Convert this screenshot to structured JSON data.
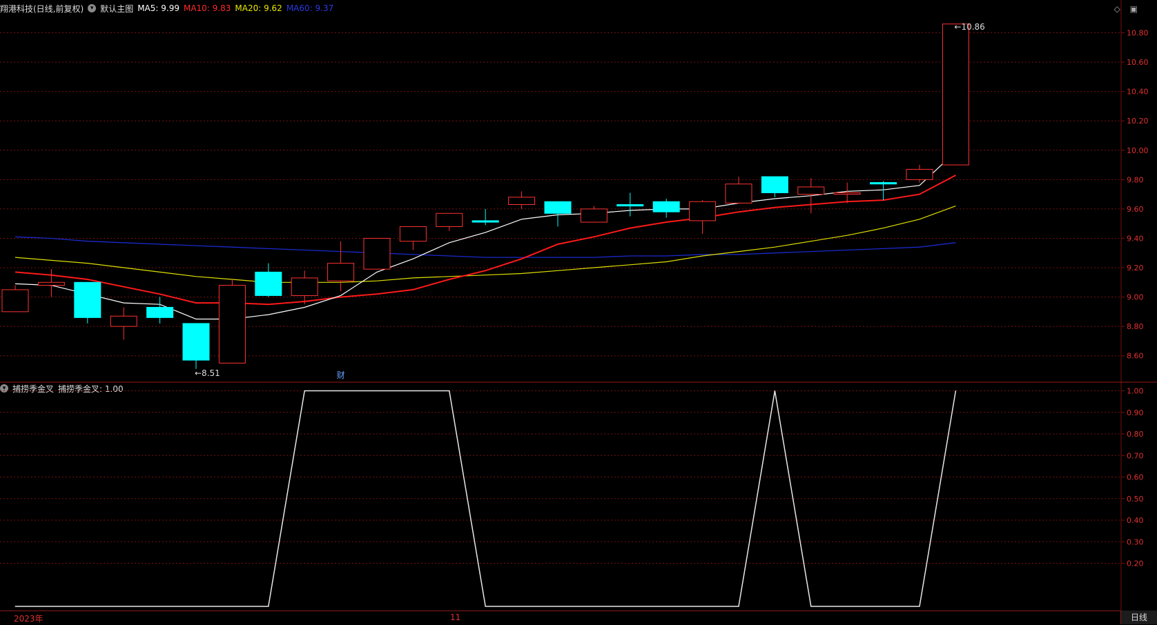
{
  "header": {
    "stock_title": "翔港科技(日线,前复权)",
    "chart_name": "默认主图",
    "ma5_label": "MA5: 9.99",
    "ma10_label": "MA10: 9.83",
    "ma20_label": "MA20: 9.62",
    "ma60_label": "MA60: 9.37"
  },
  "indicator": {
    "name": "捕捞季金叉",
    "value_label": "捕捞季金叉: 1.00"
  },
  "bottom": {
    "year_label": "2023年",
    "month_label": "11",
    "period_tab": "日线"
  },
  "colors": {
    "up": "#ff3333",
    "down": "#00ffff",
    "ma5": "#ffffff",
    "ma10": "#ff1a1a",
    "ma20": "#e0e000",
    "ma60": "#1a2acc",
    "grid": "#7a1010",
    "axis_text": "#e03030"
  },
  "chart_data": [
    {
      "type": "candlestick",
      "title": "翔港科技(日线,前复权)",
      "ylim": [
        8.42,
        10.92
      ],
      "y_ticks": [
        "10.80",
        "10.60",
        "10.40",
        "10.20",
        "10.00",
        "9.80",
        "9.60",
        "9.40",
        "9.20",
        "9.00",
        "8.80",
        "8.60"
      ],
      "candles": [
        {
          "o": 8.9,
          "h": 9.08,
          "l": 8.9,
          "c": 9.05
        },
        {
          "o": 9.08,
          "h": 9.19,
          "l": 9.0,
          "c": 9.1
        },
        {
          "o": 9.1,
          "h": 9.1,
          "l": 8.82,
          "c": 8.86
        },
        {
          "o": 8.8,
          "h": 8.93,
          "l": 8.71,
          "c": 8.87
        },
        {
          "o": 8.93,
          "h": 9.0,
          "l": 8.82,
          "c": 8.86
        },
        {
          "o": 8.82,
          "h": 8.82,
          "l": 8.51,
          "c": 8.57
        },
        {
          "o": 8.55,
          "h": 9.12,
          "l": 8.55,
          "c": 9.08
        },
        {
          "o": 9.17,
          "h": 9.23,
          "l": 9.0,
          "c": 9.01
        },
        {
          "o": 9.01,
          "h": 9.18,
          "l": 8.95,
          "c": 9.13
        },
        {
          "o": 9.11,
          "h": 9.38,
          "l": 9.04,
          "c": 9.23
        },
        {
          "o": 9.19,
          "h": 9.4,
          "l": 9.19,
          "c": 9.4
        },
        {
          "o": 9.38,
          "h": 9.48,
          "l": 9.32,
          "c": 9.48
        },
        {
          "o": 9.48,
          "h": 9.56,
          "l": 9.45,
          "c": 9.57
        },
        {
          "o": 9.52,
          "h": 9.6,
          "l": 9.49,
          "c": 9.51
        },
        {
          "o": 9.63,
          "h": 9.72,
          "l": 9.6,
          "c": 9.68
        },
        {
          "o": 9.65,
          "h": 9.65,
          "l": 9.48,
          "c": 9.57
        },
        {
          "o": 9.51,
          "h": 9.62,
          "l": 9.51,
          "c": 9.6
        },
        {
          "o": 9.63,
          "h": 9.71,
          "l": 9.55,
          "c": 9.62
        },
        {
          "o": 9.65,
          "h": 9.67,
          "l": 9.54,
          "c": 9.58
        },
        {
          "o": 9.52,
          "h": 9.66,
          "l": 9.43,
          "c": 9.65
        },
        {
          "o": 9.64,
          "h": 9.82,
          "l": 9.64,
          "c": 9.77
        },
        {
          "o": 9.82,
          "h": 9.82,
          "l": 9.68,
          "c": 9.71
        },
        {
          "o": 9.7,
          "h": 9.81,
          "l": 9.57,
          "c": 9.75
        },
        {
          "o": 9.71,
          "h": 9.78,
          "l": 9.64,
          "c": 9.71
        },
        {
          "o": 9.78,
          "h": 9.79,
          "l": 9.66,
          "c": 9.77
        },
        {
          "o": 9.8,
          "h": 9.9,
          "l": 9.78,
          "c": 9.87
        },
        {
          "o": 9.9,
          "h": 10.86,
          "l": 9.9,
          "c": 10.86
        }
      ],
      "ma5": [
        9.09,
        9.08,
        9.02,
        8.96,
        8.95,
        8.85,
        8.85,
        8.88,
        8.93,
        9.01,
        9.17,
        9.26,
        9.37,
        9.44,
        9.53,
        9.56,
        9.57,
        9.59,
        9.6,
        9.6,
        9.64,
        9.67,
        9.69,
        9.72,
        9.73,
        9.76,
        9.99
      ],
      "ma10": [
        9.17,
        9.15,
        9.12,
        9.07,
        9.02,
        8.96,
        8.96,
        8.95,
        8.97,
        9.0,
        9.02,
        9.05,
        9.12,
        9.18,
        9.26,
        9.36,
        9.41,
        9.47,
        9.51,
        9.54,
        9.58,
        9.61,
        9.63,
        9.65,
        9.66,
        9.7,
        9.83
      ],
      "ma20": [
        9.27,
        9.25,
        9.23,
        9.2,
        9.17,
        9.14,
        9.12,
        9.1,
        9.1,
        9.1,
        9.11,
        9.13,
        9.14,
        9.15,
        9.16,
        9.18,
        9.2,
        9.22,
        9.24,
        9.28,
        9.31,
        9.34,
        9.38,
        9.42,
        9.47,
        9.53,
        9.62
      ],
      "ma60": [
        9.41,
        9.4,
        9.38,
        9.37,
        9.36,
        9.35,
        9.34,
        9.33,
        9.32,
        9.31,
        9.3,
        9.29,
        9.28,
        9.27,
        9.27,
        9.27,
        9.27,
        9.28,
        9.28,
        9.29,
        9.29,
        9.3,
        9.31,
        9.32,
        9.33,
        9.34,
        9.37
      ],
      "annotations": [
        {
          "index": 5,
          "text": "8.51"
        },
        {
          "index": 26,
          "text": "10.86"
        },
        {
          "index": 9,
          "text": "财"
        }
      ]
    },
    {
      "type": "line",
      "title": "捕捞季金叉",
      "ylim": [
        0,
        1.04
      ],
      "y_ticks": [
        "1.00",
        "0.90",
        "0.80",
        "0.70",
        "0.60",
        "0.50",
        "0.40",
        "0.30",
        "0.20"
      ],
      "values": [
        0,
        0,
        0,
        0,
        0,
        0,
        0,
        0,
        1,
        1,
        1,
        1,
        1,
        0,
        0,
        0,
        0,
        0,
        0,
        0,
        0,
        1,
        0,
        0,
        0,
        0,
        1
      ]
    }
  ]
}
